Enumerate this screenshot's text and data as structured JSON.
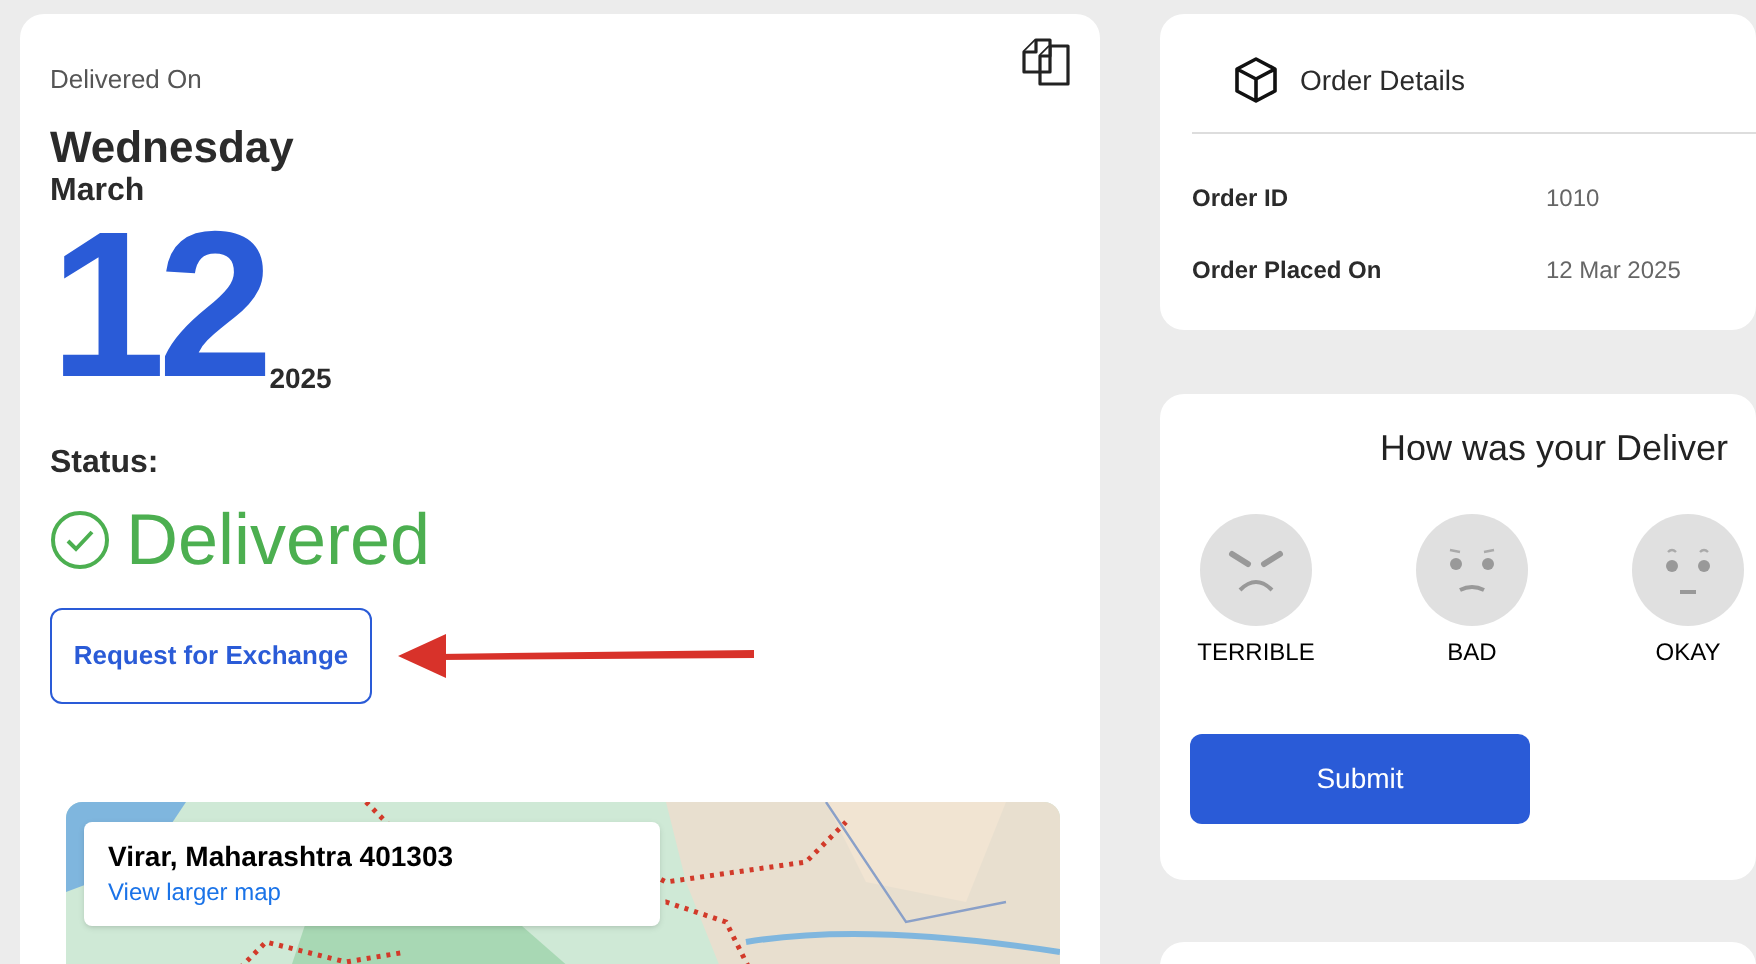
{
  "delivery": {
    "heading": "Delivered On",
    "weekday": "Wednesday",
    "month": "March",
    "day": "12",
    "year": "2025",
    "status_label": "Status:",
    "status": "Delivered",
    "exchange_button": "Request for Exchange"
  },
  "map": {
    "kind": "picture",
    "place": "Virar, Maharashtra 401303",
    "link": "View larger map"
  },
  "order_details": {
    "title": "Order Details",
    "rows": [
      {
        "label": "Order ID",
        "value": "1010"
      },
      {
        "label": "Order Placed On",
        "value": "12 Mar 2025"
      }
    ]
  },
  "feedback": {
    "title": "How was your Deliver",
    "ratings": [
      {
        "label": "TERRIBLE",
        "kind": "terrible",
        "selected": false
      },
      {
        "label": "BAD",
        "kind": "bad",
        "selected": false
      },
      {
        "label": "OKAY",
        "kind": "okay",
        "selected": false
      }
    ],
    "submit": "Submit"
  }
}
